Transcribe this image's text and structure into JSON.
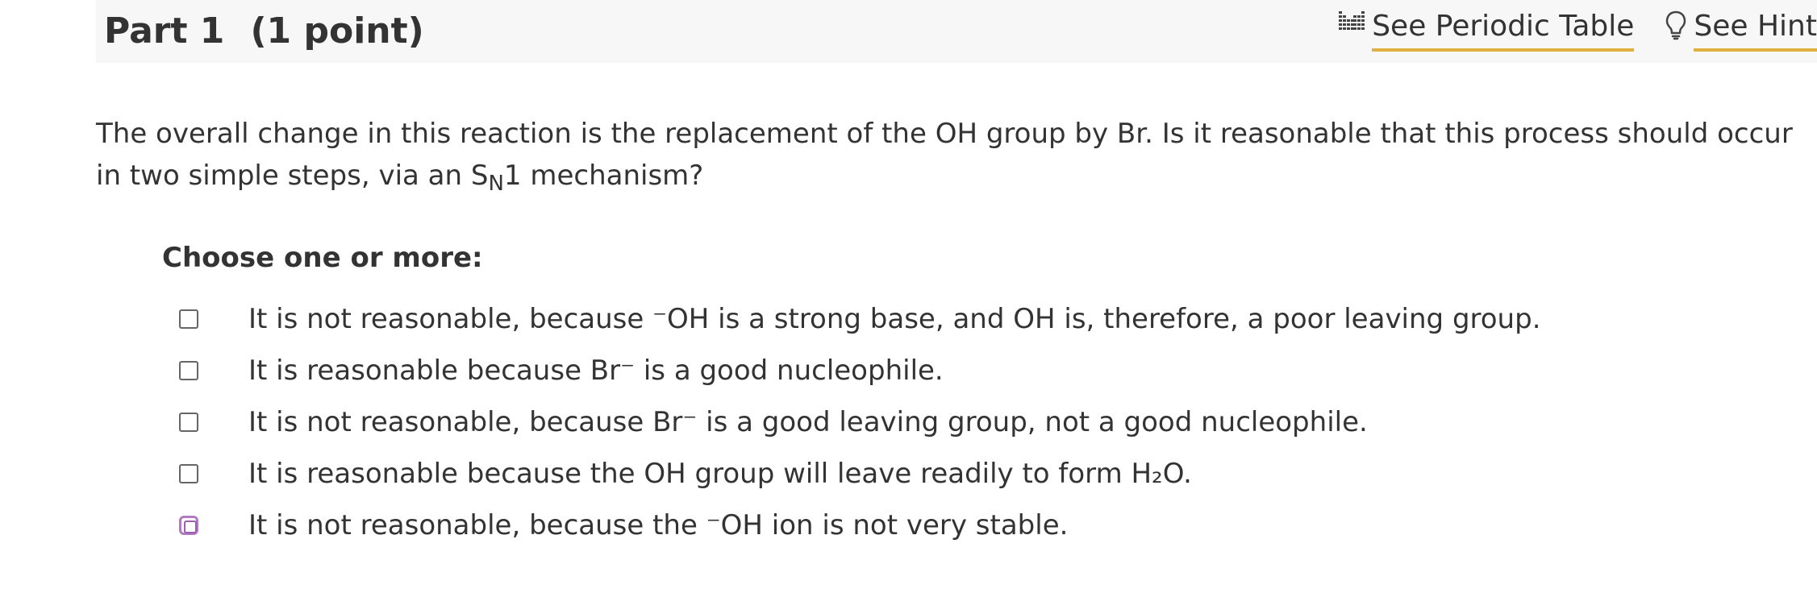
{
  "header": {
    "part_label": "Part 1",
    "points_label": "(1 point)",
    "periodic_table_link": "See Periodic Table",
    "hint_link": "See Hint"
  },
  "question": {
    "text_before": "The overall change in this reaction is the replacement of the OH group by Br. Is it reasonable that this process should occur in two simple steps, via an S",
    "subscript": "N",
    "text_after": "1 mechanism?"
  },
  "choose_label": "Choose one or more:",
  "options": [
    {
      "text": "It is not reasonable, because ⁻OH is a strong base, and OH is, therefore, a poor leaving group.",
      "checked": false
    },
    {
      "text": "It is reasonable because Br⁻ is a good nucleophile.",
      "checked": false
    },
    {
      "text": "It is not reasonable, because Br⁻ is a good leaving group, not a good nucleophile.",
      "checked": false
    },
    {
      "text": "It is reasonable because the OH group will leave readily to form H₂O.",
      "checked": false
    },
    {
      "text": "It is not reasonable, because the ⁻OH ion is not very stable.",
      "checked": false,
      "focused": true
    }
  ],
  "colors": {
    "header_bg": "#f7f7f7",
    "link_underline": "#e0b13f",
    "focus_ring": "#b07bbf",
    "text": "#333333"
  },
  "icons": {
    "periodic_table": "periodic-table-icon",
    "hint": "lightbulb-icon"
  }
}
